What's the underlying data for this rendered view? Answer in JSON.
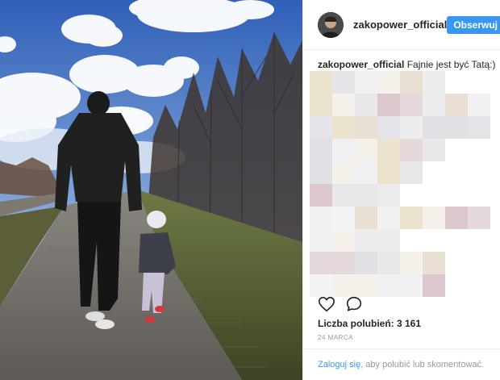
{
  "post": {
    "username": "zakopower_official",
    "follow_label": "Obserwuj",
    "caption_user": "zakopower_official",
    "caption_text": "Fajnie jest być Tatą:)",
    "likes_label": "Liczba polubień: 3 161",
    "date": "24 MARCA",
    "login_link": "Zaloguj się",
    "login_suffix": ", aby polubić lub skomentować."
  },
  "icons": {
    "like": "heart-icon",
    "comment": "speech-bubble-icon"
  },
  "colors": {
    "accent": "#3897f0",
    "text": "#262626",
    "muted": "#999999",
    "border": "#efefef"
  }
}
